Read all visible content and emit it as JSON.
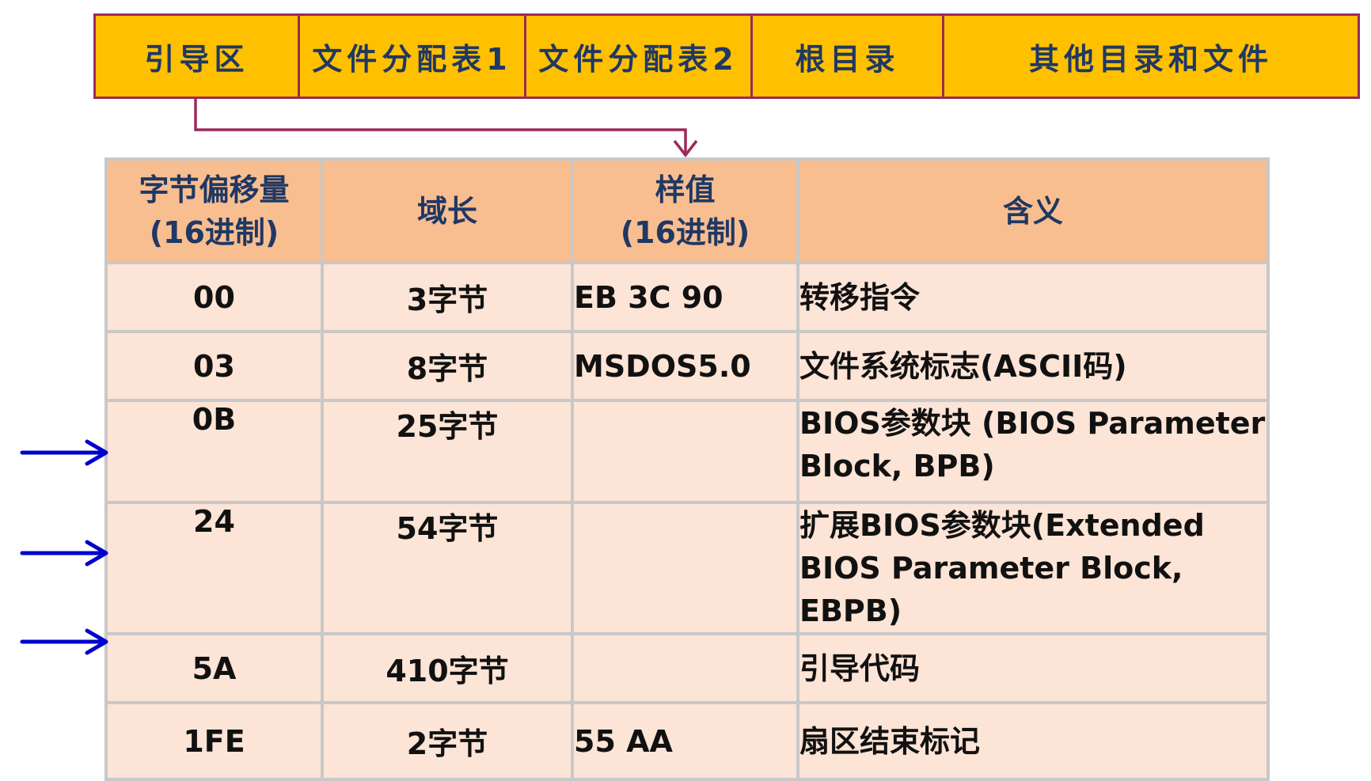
{
  "fat_regions": [
    "引导区",
    "文件分配表1",
    "文件分配表2",
    "根目录",
    "其他目录和文件"
  ],
  "table": {
    "headers": [
      {
        "line1": "字节偏移量",
        "line2": "(16进制)"
      },
      {
        "line1": "域长",
        "line2": ""
      },
      {
        "line1": "样值",
        "line2": "(16进制)"
      },
      {
        "line1": "含义",
        "line2": ""
      }
    ],
    "rows": [
      {
        "offset": "00",
        "length": "3字节",
        "sample": "EB 3C 90",
        "meaning": "转移指令"
      },
      {
        "offset": "03",
        "length": "8字节",
        "sample": "MSDOS5.0",
        "meaning": "文件系统标志(ASCII码)"
      },
      {
        "offset": "0B",
        "length": "25字节",
        "sample": "",
        "meaning": "BIOS参数块 (BIOS Parameter Block, BPB)"
      },
      {
        "offset": "24",
        "length": "54字节",
        "sample": "",
        "meaning": "扩展BIOS参数块(Extended BIOS Parameter Block, EBPB)"
      },
      {
        "offset": "5A",
        "length": "410字节",
        "sample": "",
        "meaning": "引导代码"
      },
      {
        "offset": "1FE",
        "length": "2字节",
        "sample": "55 AA",
        "meaning": "扇区结束标记"
      }
    ]
  },
  "colors": {
    "bar_fill": "#ffc000",
    "bar_border": "#9c2a5a",
    "header_fill": "#f9be8f",
    "row_fill": "#fce4d6",
    "arrow_color": "#0000cc",
    "connector_color": "#9c2a5a"
  },
  "highlighted_rows": [
    "0B",
    "24",
    "5A"
  ]
}
